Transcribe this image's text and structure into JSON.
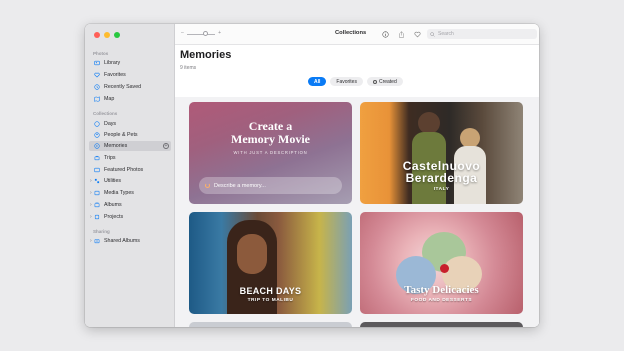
{
  "window": {
    "title": "Collections"
  },
  "sidebar": {
    "sections": [
      {
        "heading": "Photos",
        "items": [
          {
            "label": "Library",
            "icon": "photo-library-icon"
          },
          {
            "label": "Favorites",
            "icon": "heart-icon"
          },
          {
            "label": "Recently Saved",
            "icon": "clock-icon"
          },
          {
            "label": "Map",
            "icon": "map-icon"
          }
        ]
      },
      {
        "heading": "Collections",
        "items": [
          {
            "label": "Days",
            "icon": "calendar-icon"
          },
          {
            "label": "People & Pets",
            "icon": "person-icon"
          },
          {
            "label": "Memories",
            "icon": "memories-icon",
            "active": true
          },
          {
            "label": "Trips",
            "icon": "suitcase-icon"
          },
          {
            "label": "Featured Photos",
            "icon": "star-photo-icon"
          },
          {
            "label": "Utilities",
            "icon": "utilities-icon"
          },
          {
            "label": "Media Types",
            "icon": "media-icon"
          },
          {
            "label": "Albums",
            "icon": "album-icon"
          },
          {
            "label": "Projects",
            "icon": "project-icon"
          }
        ]
      },
      {
        "heading": "Sharing",
        "items": [
          {
            "label": "Shared Albums",
            "icon": "shared-album-icon"
          }
        ]
      }
    ]
  },
  "search": {
    "placeholder": "Search"
  },
  "main": {
    "title": "Memories",
    "subtitle": "9 items",
    "filters": [
      {
        "label": "All",
        "selected": true
      },
      {
        "label": "Favorites"
      },
      {
        "label": "Created"
      }
    ]
  },
  "cards": {
    "create": {
      "title_line1": "Create a",
      "title_line2": "Memory Movie",
      "subtitle": "WITH JUST A DESCRIPTION",
      "placeholder": "Describe a memory..."
    },
    "italy": {
      "title_line1": "Castelnuovo",
      "title_line2": "Berardenga",
      "subtitle": "ITALY"
    },
    "beach": {
      "title": "BEACH DAYS",
      "subtitle": "TRIP TO MALIBU"
    },
    "food": {
      "title": "Tasty Delicacies",
      "subtitle": "FOOD AND DESSERTS"
    }
  },
  "colors": {
    "accent": "#0a7bf5",
    "sidebar_bg": "#e3e3e5"
  }
}
